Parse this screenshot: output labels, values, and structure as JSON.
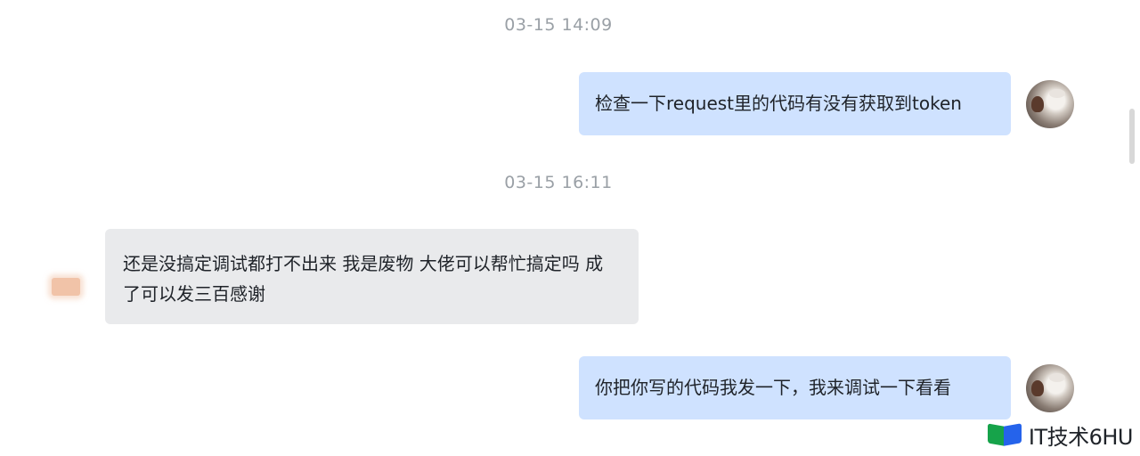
{
  "conversation": {
    "messages": [
      {
        "type": "timestamp",
        "text": "03-15 14:09"
      },
      {
        "type": "message",
        "side": "right",
        "text": "检查一下request里的代码有没有获取到token"
      },
      {
        "type": "timestamp",
        "text": "03-15 16:11"
      },
      {
        "type": "message",
        "side": "left",
        "text": "还是没搞定调试都打不出来 我是废物 大佬可以帮忙搞定吗 成了可以发三百感谢"
      },
      {
        "type": "message",
        "side": "right",
        "text": "你把你写的代码我发一下，我来调试一下看看"
      }
    ]
  },
  "watermark": {
    "text": "IT技术6HU"
  },
  "colors": {
    "my_bubble": "#cfe2ff",
    "their_bubble": "#e9eaec",
    "timestamp_text": "#9aa0a6",
    "message_text": "#1f2329"
  }
}
